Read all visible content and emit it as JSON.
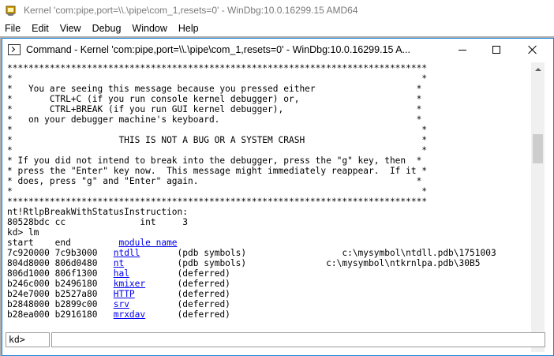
{
  "app": {
    "title": "Kernel 'com:pipe,port=\\\\.\\pipe\\com_1,resets=0' - WinDbg:10.0.16299.15 AMD64"
  },
  "menu": {
    "items": [
      "File",
      "Edit",
      "View",
      "Debug",
      "Window",
      "Help"
    ]
  },
  "command_window": {
    "title": "Command - Kernel 'com:pipe,port=\\\\.\\pipe\\com_1,resets=0' - WinDbg:10.0.16299.15 A...",
    "prompt": "kd>",
    "input_value": ""
  },
  "output": {
    "banner_border": "*******************************************************************************",
    "banner_lines": [
      "*                                                                             *",
      "*   You are seeing this message because you pressed either                   *",
      "*       CTRL+C (if you run console kernel debugger) or,                      *",
      "*       CTRL+BREAK (if you run GUI kernel debugger),                         *",
      "*   on your debugger machine's keyboard.                                     *",
      "*                                                                             *",
      "*                    THIS IS NOT A BUG OR A SYSTEM CRASH                      *",
      "*                                                                             *",
      "* If you did not intend to break into the debugger, press the \"g\" key, then  *",
      "* press the \"Enter\" key now.  This message might immediately reappear.  If it *",
      "* does, press \"g\" and \"Enter\" again.                                         *",
      "*                                                                             *"
    ],
    "break_lines": [
      "nt!RtlpBreakWithStatusInstruction:",
      "80528bdc cc              int     3",
      "kd> lm"
    ],
    "module_header": {
      "start": "start",
      "end": "end",
      "name": "module name"
    },
    "modules": [
      {
        "start": "7c920000",
        "end": "7c9b3000",
        "name": "ntdll",
        "info": "(pdb symbols)",
        "path": "c:\\mysymbol\\ntdll.pdb\\1751003"
      },
      {
        "start": "804d8000",
        "end": "806d0480",
        "name": "nt",
        "info": "(pdb symbols)",
        "path": "c:\\mysymbol\\ntkrnlpa.pdb\\30B5"
      },
      {
        "start": "806d1000",
        "end": "806f1300",
        "name": "hal",
        "info": "(deferred)",
        "path": ""
      },
      {
        "start": "b246c000",
        "end": "b2496180",
        "name": "kmixer",
        "info": "(deferred)",
        "path": ""
      },
      {
        "start": "b24e7000",
        "end": "b2527a80",
        "name": "HTTP",
        "info": "(deferred)",
        "path": ""
      },
      {
        "start": "b2848000",
        "end": "b2899c00",
        "name": "srv",
        "info": "(deferred)",
        "path": ""
      },
      {
        "start": "b28ea000",
        "end": "b2916180",
        "name": "mrxdav",
        "info": "(deferred)",
        "path": ""
      }
    ]
  },
  "colors": {
    "link": "#0000ee",
    "window_border": "#1883d7",
    "mdi_background": "#ababab"
  }
}
